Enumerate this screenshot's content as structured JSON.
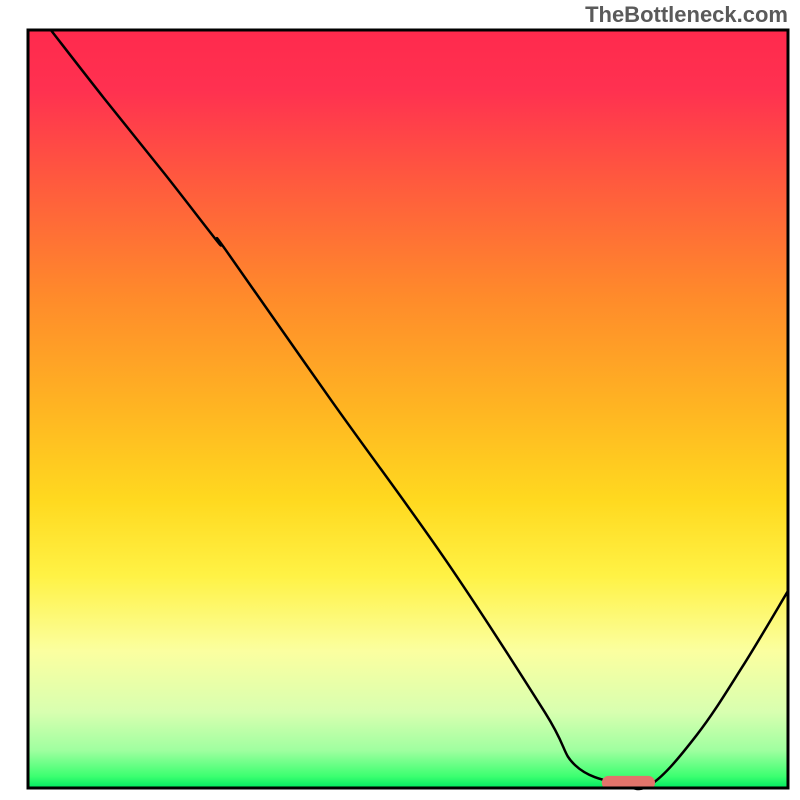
{
  "watermark": "TheBottleneck.com",
  "chart_data": {
    "type": "line",
    "title": "",
    "xlabel": "",
    "ylabel": "",
    "xlim": [
      0,
      100
    ],
    "ylim": [
      0,
      100
    ],
    "axes_visible": false,
    "grid": false,
    "background": {
      "type": "vertical-gradient",
      "stops": [
        {
          "offset": 0.0,
          "color": "#ff2a4d"
        },
        {
          "offset": 0.08,
          "color": "#ff3150"
        },
        {
          "offset": 0.2,
          "color": "#ff5a3e"
        },
        {
          "offset": 0.35,
          "color": "#ff8a2b"
        },
        {
          "offset": 0.5,
          "color": "#ffb522"
        },
        {
          "offset": 0.62,
          "color": "#ffd91f"
        },
        {
          "offset": 0.72,
          "color": "#fff245"
        },
        {
          "offset": 0.82,
          "color": "#fbffa0"
        },
        {
          "offset": 0.9,
          "color": "#d8ffb0"
        },
        {
          "offset": 0.95,
          "color": "#a0ffa0"
        },
        {
          "offset": 0.985,
          "color": "#3bff70"
        },
        {
          "offset": 1.0,
          "color": "#00e860"
        }
      ]
    },
    "series": [
      {
        "name": "bottleneck-curve",
        "color": "#000000",
        "width": 2.5,
        "x": [
          3,
          10,
          18,
          25,
          26,
          40,
          55,
          68,
          72,
          78,
          82,
          88,
          94,
          100
        ],
        "y": [
          100,
          91,
          81,
          72,
          71,
          51,
          30,
          10,
          3,
          0.5,
          0.5,
          7,
          16,
          26
        ]
      }
    ],
    "marker": {
      "name": "optimal-range-marker",
      "shape": "rounded-rect",
      "x_center": 79,
      "y_center": 0.7,
      "width": 7,
      "height": 1.8,
      "color": "#e2746b"
    },
    "frame": {
      "color": "#000000",
      "width": 3
    }
  }
}
